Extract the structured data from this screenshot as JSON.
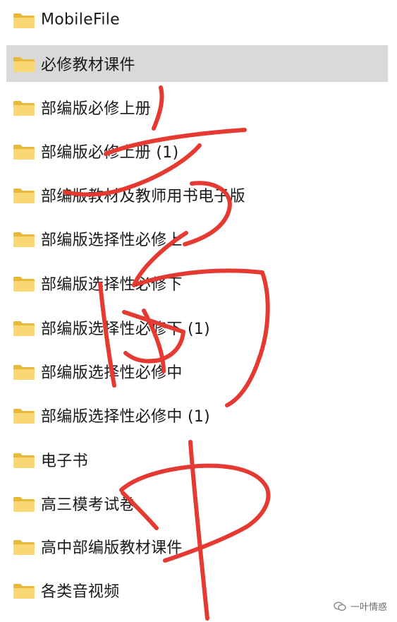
{
  "folders": [
    {
      "label": "MobileFile",
      "selected": false
    },
    {
      "label": "必修教材课件",
      "selected": true
    },
    {
      "label": "部编版必修上册",
      "selected": false
    },
    {
      "label": "部编版必修上册 (1)",
      "selected": false
    },
    {
      "label": "部编版教材及教师用书电子版",
      "selected": false
    },
    {
      "label": "部编版选择性必修上",
      "selected": false
    },
    {
      "label": "部编版选择性必修下",
      "selected": false
    },
    {
      "label": "部编版选择性必修下 (1)",
      "selected": false
    },
    {
      "label": "部编版选择性必修中",
      "selected": false
    },
    {
      "label": "部编版选择性必修中 (1)",
      "selected": false
    },
    {
      "label": "电子书",
      "selected": false
    },
    {
      "label": "高三模考试卷",
      "selected": false
    },
    {
      "label": "高中部编版教材课件",
      "selected": false
    },
    {
      "label": "各类音视频",
      "selected": false
    }
  ],
  "watermark": {
    "text": "一叶情惑"
  },
  "colors": {
    "selection": "#d9d9d9",
    "folder_back": "#e8b838",
    "folder_front": "#f8d774",
    "ink": "#e53a32"
  },
  "icons": {
    "folder": "folder-icon",
    "watermark": "wechat-icon"
  }
}
